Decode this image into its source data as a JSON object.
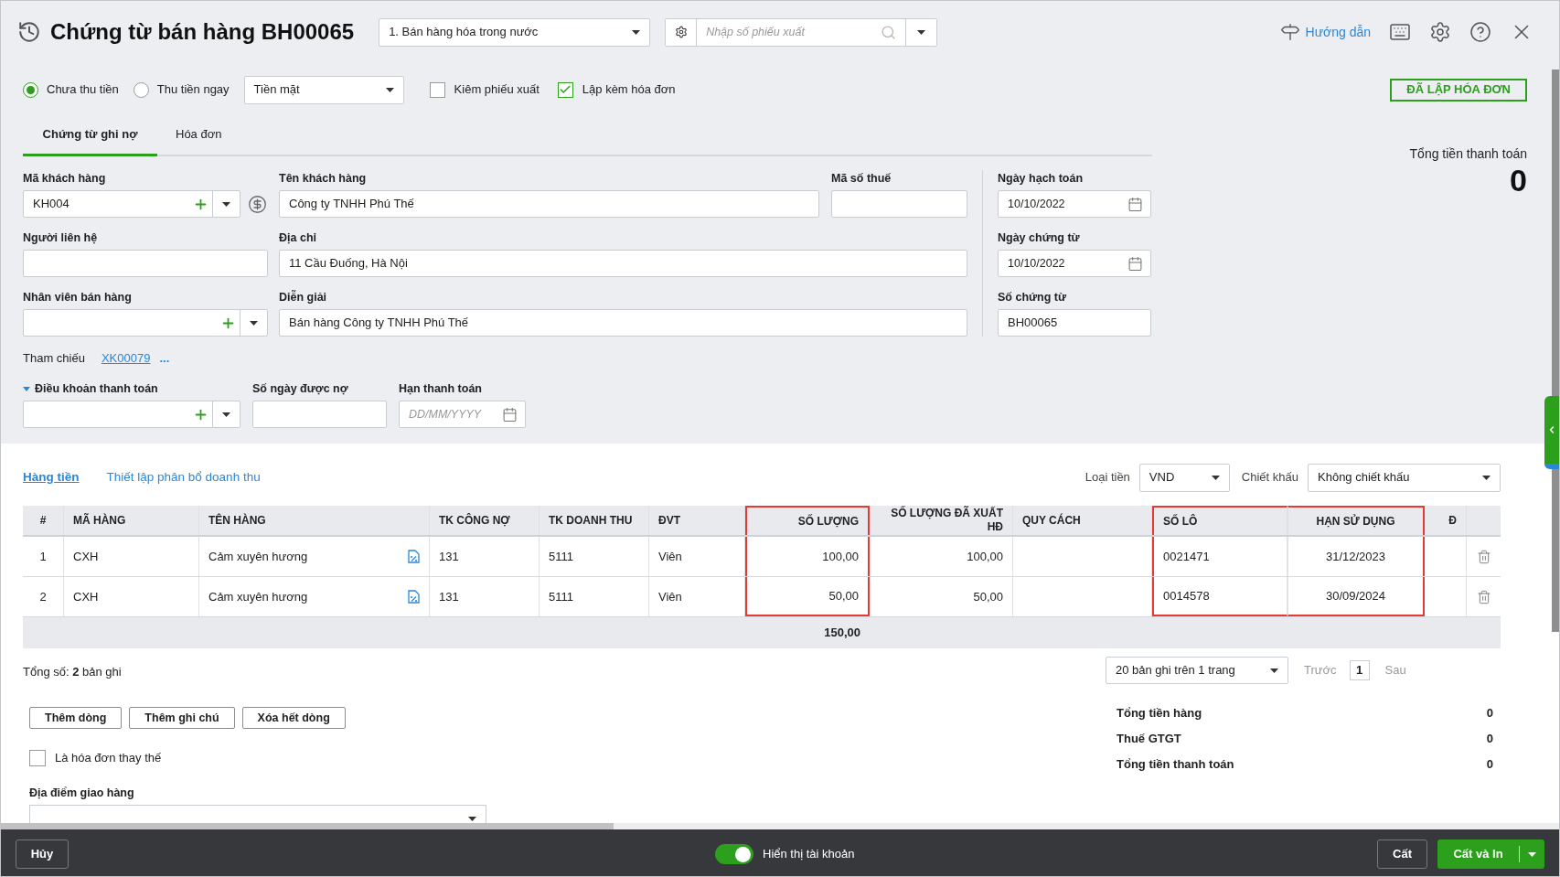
{
  "header": {
    "title": "Chứng từ bán hàng BH00065",
    "transaction_type": "1. Bán hàng hóa trong nước",
    "search_placeholder": "Nhập số phiếu xuất",
    "help_link": "Hướng dẫn"
  },
  "options": {
    "radios": [
      {
        "label": "Chưa thu tiền",
        "selected": true
      },
      {
        "label": "Thu tiền ngay",
        "selected": false
      }
    ],
    "payment_method": "Tiền mặt",
    "checkboxes": [
      {
        "label": "Kiêm phiếu xuất",
        "checked": false
      },
      {
        "label": "Lập kèm hóa đơn",
        "checked": true
      }
    ],
    "status_badge": "ĐÃ LẬP HÓA ĐƠN"
  },
  "tabs": [
    {
      "label": "Chứng từ ghi nợ",
      "selected": true
    },
    {
      "label": "Hóa đơn",
      "selected": false
    }
  ],
  "form": {
    "customer_code": {
      "label": "Mã khách hàng",
      "value": "KH004"
    },
    "customer_name": {
      "label": "Tên khách hàng",
      "value": "Công ty TNHH Phú Thế"
    },
    "tax_code": {
      "label": "Mã số thuế"
    },
    "contact": {
      "label": "Người liên hệ"
    },
    "address": {
      "label": "Địa chỉ",
      "value": "11 Cầu Đuống, Hà Nội"
    },
    "salesperson": {
      "label": "Nhân viên bán hàng"
    },
    "description": {
      "label": "Diễn giải",
      "value": "Bán hàng Công ty TNHH Phú Thế"
    },
    "posting_date": {
      "label": "Ngày hạch toán",
      "value": "10/10/2022"
    },
    "voucher_date": {
      "label": "Ngày chứng từ",
      "value": "10/10/2022"
    },
    "voucher_number": {
      "label": "Số chứng từ",
      "value": "BH00065"
    },
    "reference": {
      "label": "Tham chiếu",
      "value": "XK00079",
      "more": "..."
    },
    "payment_terms": {
      "label": "Điều khoản thanh toán",
      "expanded": true
    },
    "credit_days": {
      "label": "Số ngày được nợ"
    },
    "due_date": {
      "label": "Hạn thanh toán",
      "placeholder": "DD/MM/YYYY"
    }
  },
  "summary": {
    "label": "Tổng tiền thanh toán",
    "value": "0"
  },
  "line_tabs": [
    {
      "label": "Hàng tiền",
      "selected": true
    },
    {
      "label": "Thiết lập phân bổ doanh thu",
      "selected": false
    }
  ],
  "currency": {
    "label": "Loại tiền",
    "value": "VND"
  },
  "discount": {
    "label": "Chiết khấu",
    "value": "Không chiết khấu"
  },
  "table": {
    "columns": [
      {
        "label": "#",
        "highlighted": false
      },
      {
        "label": "MÃ HÀNG",
        "highlighted": false
      },
      {
        "label": "TÊN HÀNG",
        "highlighted": false
      },
      {
        "label": "TK CÔNG NỢ",
        "highlighted": false
      },
      {
        "label": "TK DOANH THU",
        "highlighted": false
      },
      {
        "label": "ĐVT",
        "highlighted": false
      },
      {
        "label": "SỐ LƯỢNG",
        "highlighted": true
      },
      {
        "label": "SỐ LƯỢNG ĐÃ XUẤT HĐ",
        "highlighted": false
      },
      {
        "label": "QUY CÁCH",
        "highlighted": false
      },
      {
        "label": "SỐ LÔ",
        "highlighted": true
      },
      {
        "label": "HẠN SỬ DỤNG",
        "highlighted": true
      },
      {
        "label": "Đ",
        "highlighted": false
      }
    ],
    "rows": [
      {
        "cells": [
          "1",
          "CXH",
          "Cảm xuyên hương",
          "131",
          "5111",
          "Viên",
          "100,00",
          "100,00",
          "",
          "0021471",
          "31/12/2023",
          ""
        ]
      },
      {
        "cells": [
          "2",
          "CXH",
          "Cảm xuyên hương",
          "131",
          "5111",
          "Viên",
          "50,00",
          "50,00",
          "",
          "0014578",
          "30/09/2024",
          ""
        ]
      }
    ],
    "quantity_total": "150,00"
  },
  "record_count": "Tổng số: **2** bản ghi",
  "actions": [
    "Thêm dòng",
    "Thêm ghi chú",
    "Xóa hết dòng"
  ],
  "replacement_invoice": {
    "label": "Là hóa đơn thay thế",
    "checked": false
  },
  "delivery_location": {
    "label": "Địa điểm giao hàng"
  },
  "pagination": {
    "page_size": "20 bản ghi trên 1 trang",
    "prev": "Trước",
    "page": "1",
    "next": "Sau"
  },
  "totals": [
    {
      "label": "Tổng tiền hàng",
      "value": "0"
    },
    {
      "label": "Thuế GTGT",
      "value": "0"
    },
    {
      "label": "Tổng tiền thanh toán",
      "value": "0"
    }
  ],
  "footer": {
    "cancel": "Hủy",
    "toggle": {
      "label": "Hiển thị tài khoản",
      "on": true
    },
    "save": "Cất",
    "save_print": "Cất và In"
  }
}
